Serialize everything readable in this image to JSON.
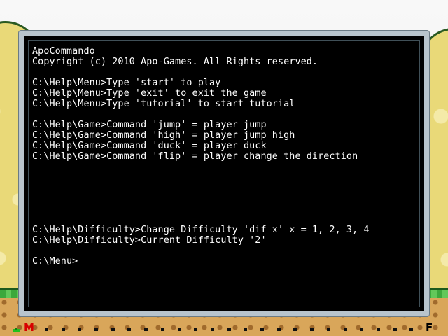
{
  "terminal": {
    "lines": [
      "ApoCommando",
      "Copyright (c) 2010 Apo-Games. All Rights reserved.",
      "",
      "C:\\Help\\Menu>Type 'start' to play",
      "C:\\Help\\Menu>Type 'exit' to exit the game",
      "C:\\Help\\Menu>Type 'tutorial' to start tutorial",
      "",
      "C:\\Help\\Game>Command 'jump' = player jump",
      "C:\\Help\\Game>Command 'high' = player jump high",
      "C:\\Help\\Game>Command 'duck' = player duck",
      "C:\\Help\\Game>Command 'flip' = player change the direction",
      "",
      "",
      "",
      "",
      "",
      "",
      "C:\\Help\\Difficulty>Change Difficulty 'dif x' x = 1, 2, 3, 4",
      "C:\\Help\\Difficulty>Current Difficulty '2'",
      "",
      "C:\\Menu>"
    ]
  },
  "hud": {
    "start_marker": "M",
    "finish_marker": "F",
    "player_progress": 0.0
  },
  "colors": {
    "terminal_bg": "#000000",
    "terminal_text": "#ffffff",
    "start_marker": "#d80000",
    "finish_marker": "#000000",
    "grass": "#3ca83c",
    "dirt": "#d9a65a"
  },
  "icons": {
    "player": "player-position-icon"
  }
}
